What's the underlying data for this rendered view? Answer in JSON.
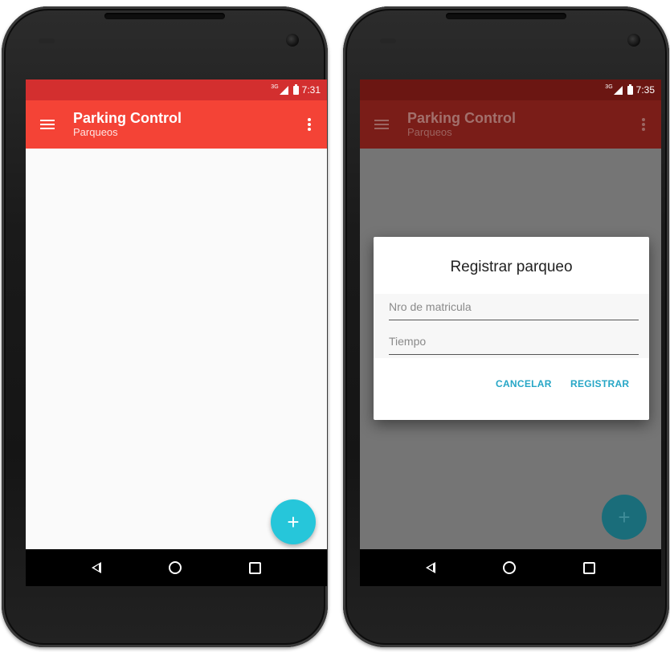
{
  "left_screen": {
    "status": {
      "network": "3G",
      "time": "7:31"
    },
    "toolbar": {
      "title": "Parking Control",
      "subtitle": "Parqueos"
    },
    "fab_label": "+"
  },
  "right_screen": {
    "status": {
      "network": "3G",
      "time": "7:35"
    },
    "toolbar": {
      "title": "Parking Control",
      "subtitle": "Parqueos"
    },
    "fab_label": "+",
    "dialog": {
      "title": "Registrar parqueo",
      "plate_placeholder": "Nro de matricula",
      "time_placeholder": "Tiempo",
      "cancel_label": "CANCELAR",
      "register_label": "REGISTRAR"
    }
  },
  "icons": {
    "menu": "hamburger-menu-icon",
    "overflow": "more-vert-icon",
    "back": "back-triangle-icon",
    "home": "home-circle-icon",
    "recents": "recents-square-icon"
  },
  "colors": {
    "primary": "#f44336",
    "primary_dark": "#d32f2f",
    "accent": "#26c6da",
    "button_text": "#26a6c6"
  }
}
